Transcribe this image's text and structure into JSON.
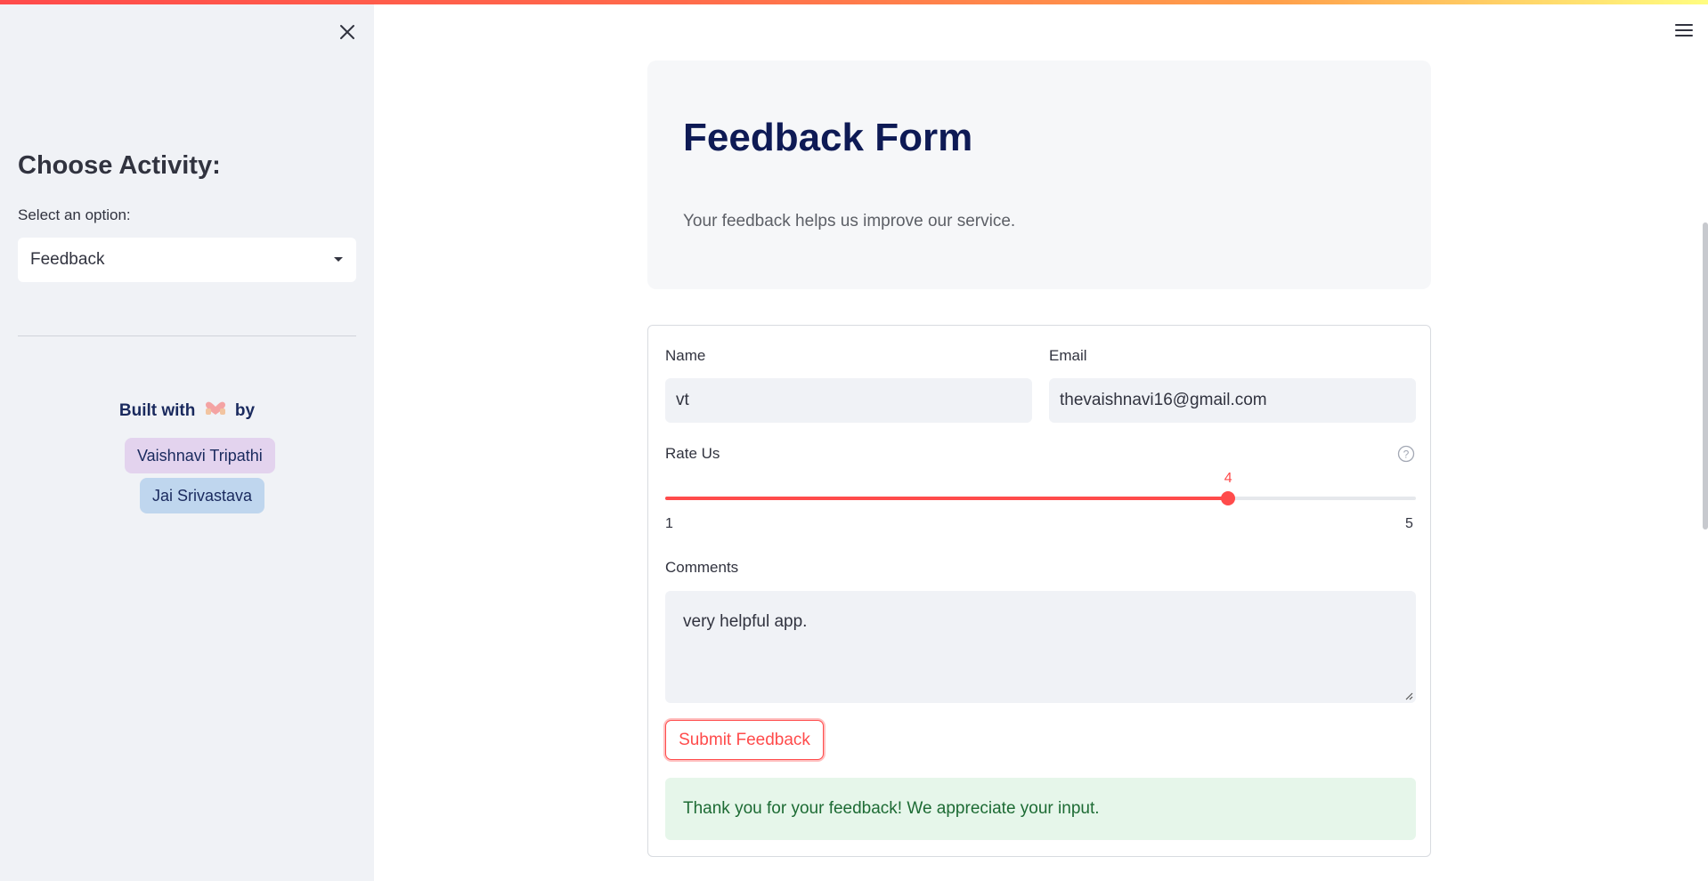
{
  "sidebar": {
    "heading": "Choose Activity:",
    "select_label": "Select an option:",
    "selected_option": "Feedback",
    "built_with_prefix": "Built with",
    "built_with_suffix": "by",
    "authors": [
      "Vaishnavi Tripathi",
      "Jai Srivastava"
    ]
  },
  "header": {
    "title": "Feedback Form",
    "subtitle": "Your feedback helps us improve our service."
  },
  "form": {
    "name_label": "Name",
    "name_value": "vt",
    "email_label": "Email",
    "email_value": "thevaishnavi16@gmail.com",
    "rating_label": "Rate Us",
    "rating": {
      "min": 1,
      "max": 5,
      "value": 4
    },
    "rating_min_label": "1",
    "rating_max_label": "5",
    "rating_value_label": "4",
    "comments_label": "Comments",
    "comments_value": "very helpful app.",
    "submit_label": "Submit Feedback",
    "success_message": "Thank you for your feedback! We appreciate your input."
  },
  "colors": {
    "accent": "#ff4b4b",
    "sidebar_bg": "#f0f2f6",
    "title": "#0e1a55",
    "success_bg": "#e6f6ea",
    "success_text": "#1d6b34",
    "chip_1": "#e3d3ee",
    "chip_2": "#bfd6ee"
  },
  "icons": {
    "close": "close-icon",
    "menu": "hamburger-menu-icon",
    "dropdown": "caret-down-icon",
    "help": "question-circle-icon",
    "heart": "heart-hands-icon"
  }
}
